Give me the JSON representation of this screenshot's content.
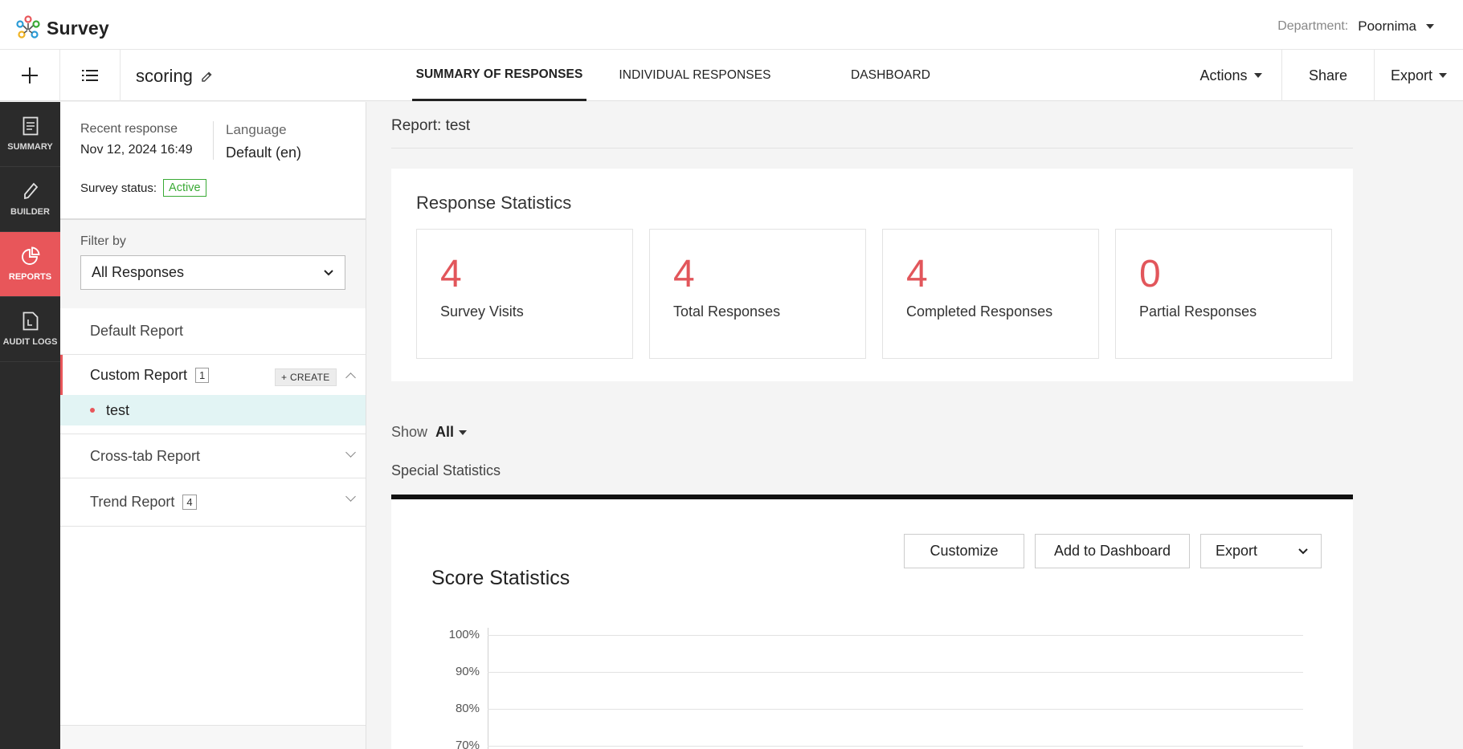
{
  "app": {
    "name": "Survey",
    "department_label": "Department:",
    "department_value": "Poornima"
  },
  "navbar": {
    "survey_name": "scoring",
    "tabs": [
      {
        "label": "SUMMARY OF RESPONSES",
        "active": true
      },
      {
        "label": "INDIVIDUAL RESPONSES",
        "active": false
      },
      {
        "label": "DASHBOARD",
        "active": false
      }
    ],
    "actions_label": "Actions",
    "share_label": "Share",
    "export_label": "Export"
  },
  "rail": {
    "items": [
      {
        "label": "SUMMARY",
        "icon": "document-icon"
      },
      {
        "label": "BUILDER",
        "icon": "pencil-icon"
      },
      {
        "label": "REPORTS",
        "icon": "pie-chart-icon",
        "active": true
      },
      {
        "label": "AUDIT LOGS",
        "icon": "log-file-icon"
      }
    ]
  },
  "panel": {
    "recent_label": "Recent response",
    "recent_value": "Nov 12, 2024 16:49",
    "language_label": "Language",
    "language_value": "Default (en)",
    "status_label": "Survey status:",
    "status_value": "Active",
    "filter_label": "Filter by",
    "filter_value": "All Responses",
    "reports": {
      "default": "Default Report",
      "custom": "Custom Report",
      "custom_count": "1",
      "create_label": "+ CREATE",
      "custom_items": [
        "test"
      ],
      "crosstab": "Cross-tab Report",
      "trend": "Trend Report",
      "trend_count": "4"
    }
  },
  "main": {
    "report_title": "Report: test",
    "stats_heading": "Response Statistics",
    "stats": [
      {
        "value": "4",
        "label": "Survey Visits"
      },
      {
        "value": "4",
        "label": "Total Responses"
      },
      {
        "value": "4",
        "label": "Completed Responses"
      },
      {
        "value": "0",
        "label": "Partial Responses"
      }
    ],
    "show_label": "Show",
    "show_value": "All",
    "special_label": "Special Statistics",
    "score_title": "Score Statistics",
    "customize_label": "Customize",
    "add_dashboard_label": "Add to Dashboard",
    "export_label": "Export",
    "y_ticks": [
      "100%",
      "90%",
      "80%",
      "70%"
    ]
  },
  "colors": {
    "accent": "#e8565a",
    "stat_number": "#e2565b",
    "active_badge": "#3aaa35",
    "rail_bg": "#2b2b2b",
    "selected_row": "#e2f4f4"
  }
}
